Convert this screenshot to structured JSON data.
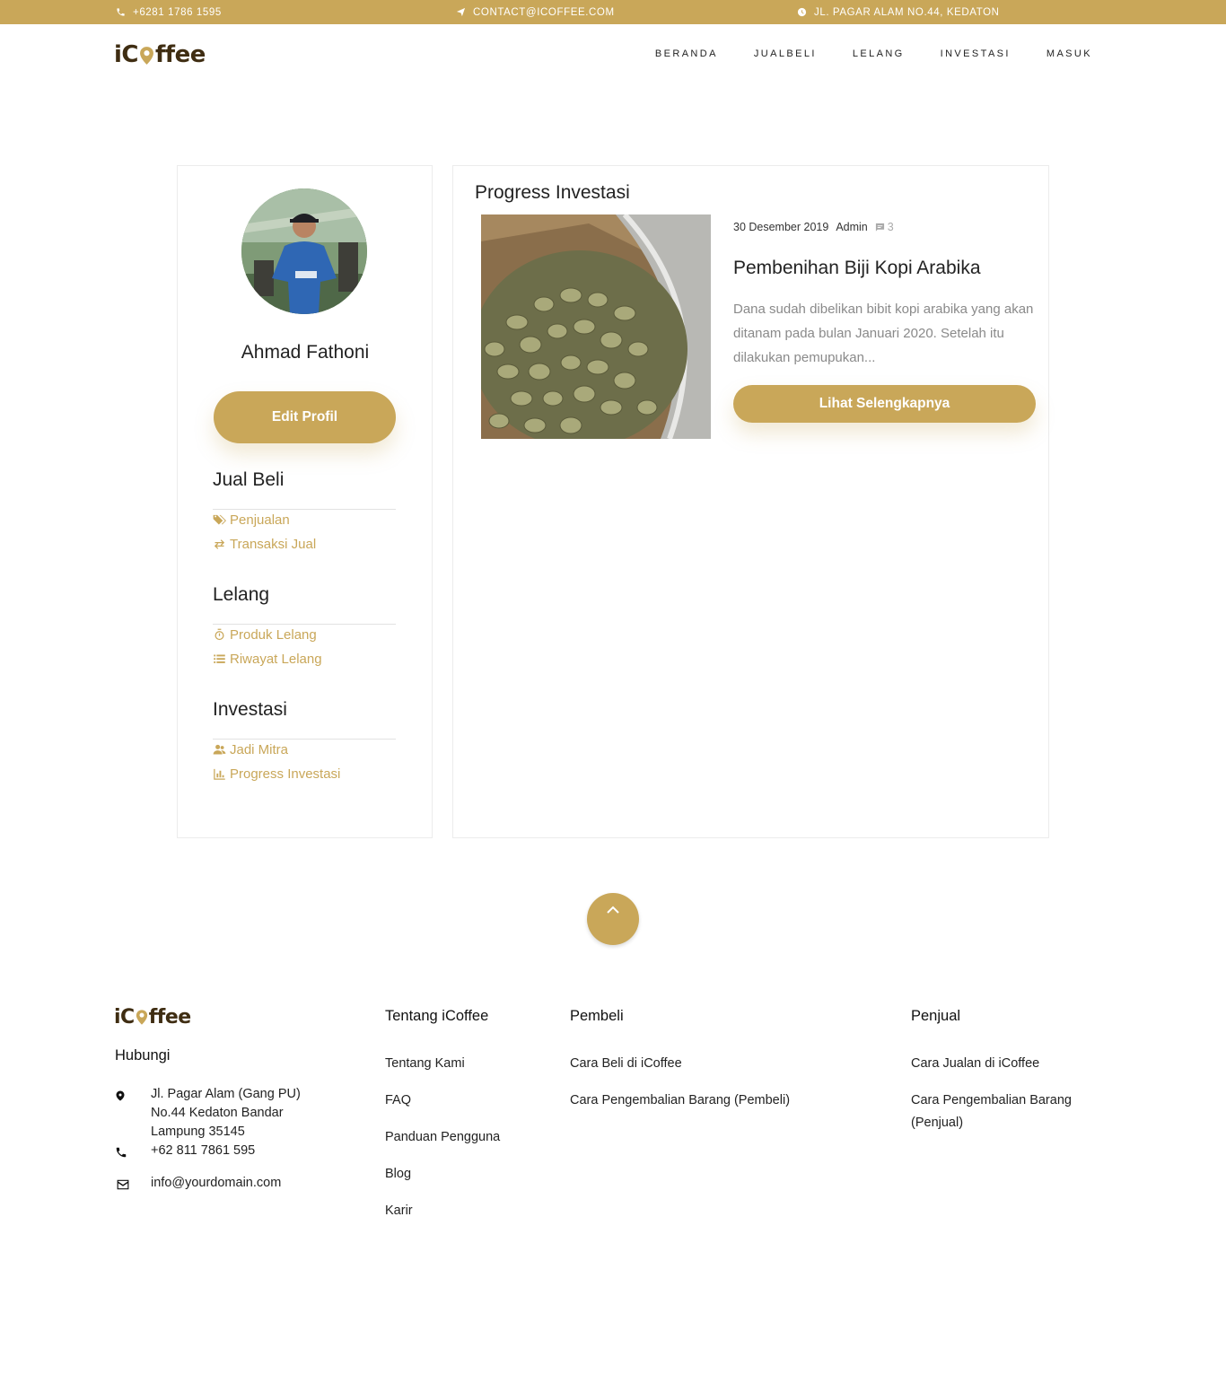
{
  "topbar": {
    "phone": "+6281 1786 1595",
    "email": "CONTACT@ICOFFEE.COM",
    "address": "JL. PAGAR ALAM NO.44, KEDATON"
  },
  "brand": {
    "logo_text_a": "iC",
    "logo_text_b": "ffee"
  },
  "nav": {
    "items": [
      "BERANDA",
      "JUALBELI",
      "LELANG",
      "INVESTASI",
      "MASUK"
    ]
  },
  "profile": {
    "name": "Ahmad Fathoni",
    "edit_button": "Edit Profil"
  },
  "sidebar": {
    "jual_beli": {
      "title": "Jual Beli",
      "links": [
        "Penjualan",
        "Transaksi Jual"
      ]
    },
    "lelang": {
      "title": "Lelang",
      "links": [
        "Produk Lelang",
        "Riwayat Lelang"
      ]
    },
    "investasi": {
      "title": "Investasi",
      "links": [
        "Jadi Mitra",
        "Progress Investasi"
      ]
    }
  },
  "main": {
    "title": "Progress Investasi",
    "post": {
      "date": "30 Desember 2019",
      "author": "Admin",
      "comments": "3",
      "title": "Pembenihan Biji Kopi Arabika",
      "excerpt": "Dana sudah dibelikan bibit kopi arabika yang akan ditanam pada bulan Januari 2020. Setelah itu dilakukan pemupukan...",
      "button": "Lihat Selengkapnya"
    }
  },
  "footer": {
    "contact_title": "Hubungi",
    "address_lines": [
      "Jl. Pagar Alam (Gang PU)",
      "No.44 Kedaton Bandar",
      "Lampung 35145"
    ],
    "phone": "+62 811 7861 595",
    "email": "info@yourdomain.com",
    "about": {
      "title": "Tentang iCoffee",
      "links": [
        "Tentang Kami",
        "FAQ",
        "Panduan Pengguna",
        "Blog",
        "Karir"
      ]
    },
    "buyer": {
      "title": "Pembeli",
      "links": [
        "Cara Beli di iCoffee",
        "Cara Pengembalian Barang (Pembeli)"
      ]
    },
    "seller": {
      "title": "Penjual",
      "links": [
        "Cara Jualan di iCoffee",
        "Cara Pengembalian Barang",
        "(Penjual)"
      ]
    }
  },
  "colors": {
    "accent": "#c9a759",
    "brand_dark": "#3f2d12"
  },
  "icons": [
    "phone-icon",
    "paper-plane-icon",
    "clock-icon",
    "tags-icon",
    "exchange-icon",
    "stopwatch-icon",
    "list-icon",
    "users-icon",
    "bar-chart-icon",
    "comment-icon",
    "chevron-up-icon",
    "map-marker-icon",
    "envelope-icon"
  ]
}
